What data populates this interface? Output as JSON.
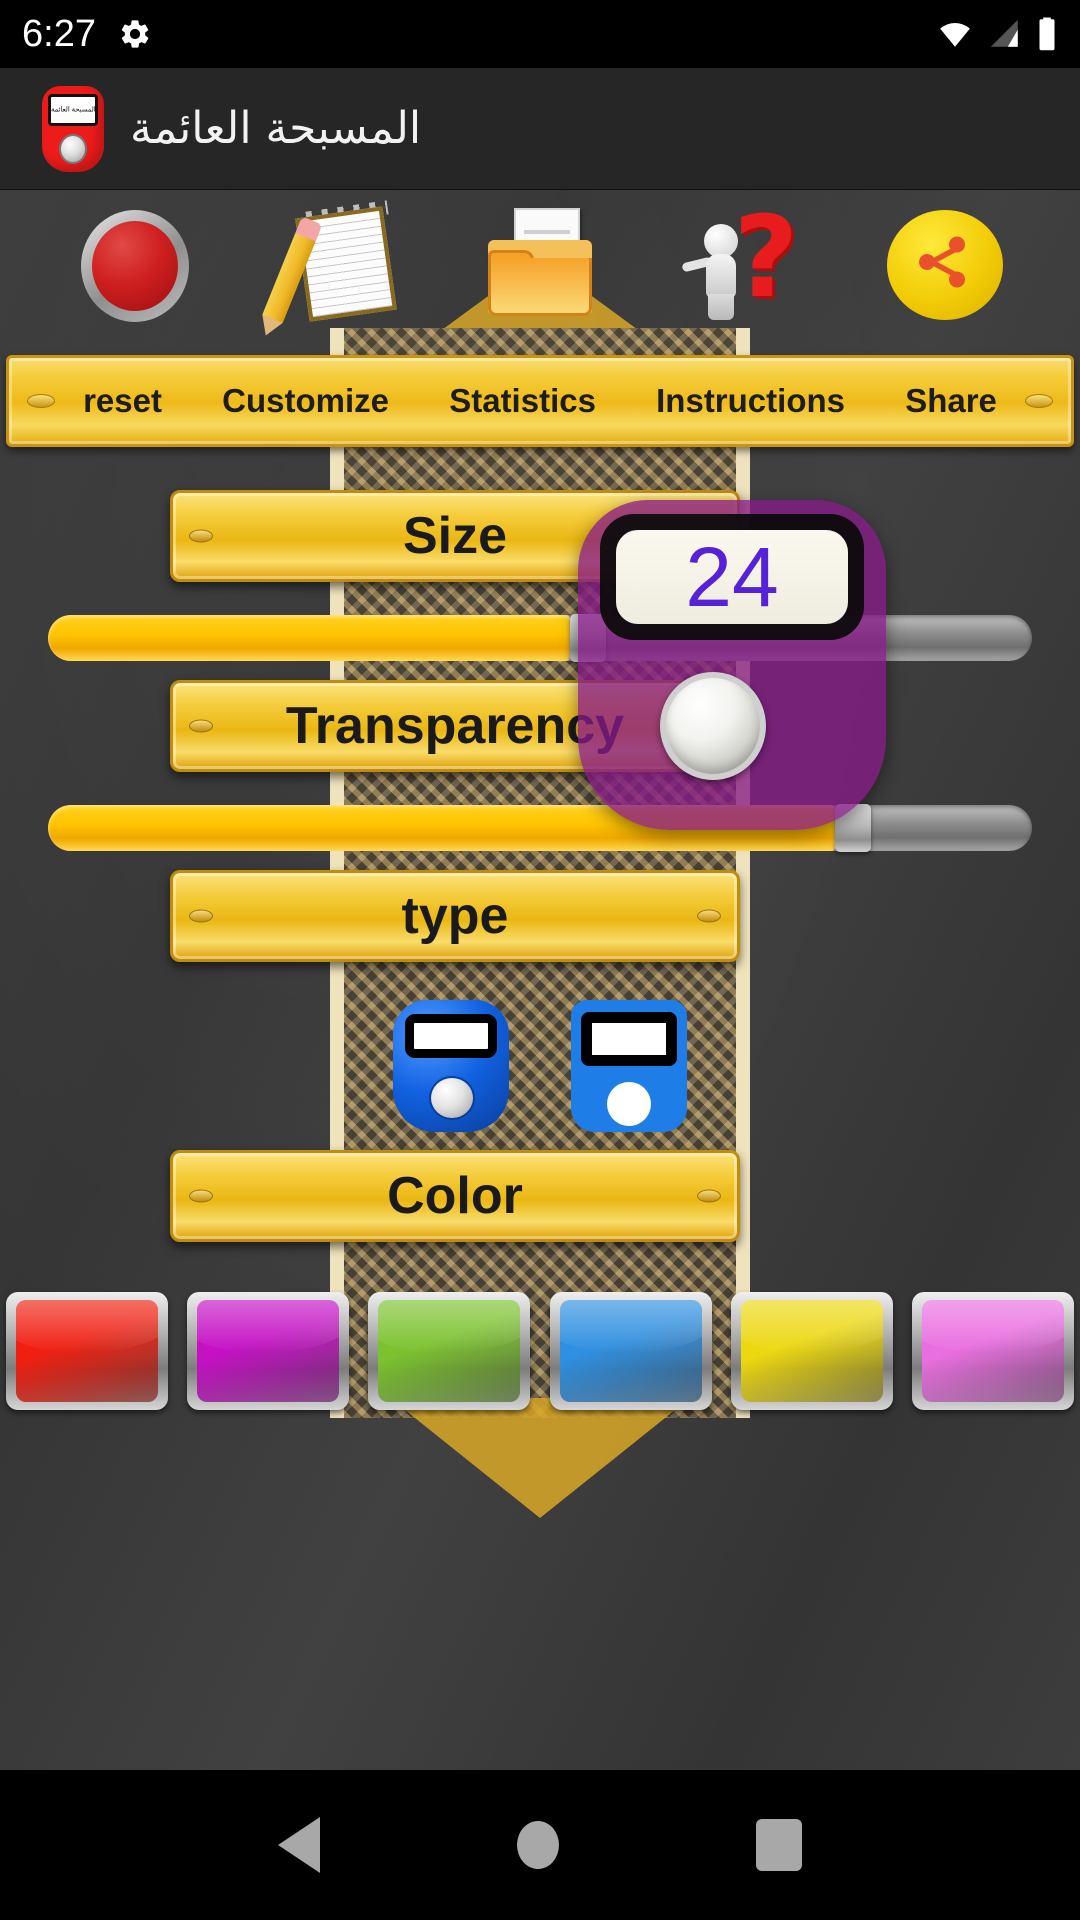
{
  "status_bar": {
    "time": "6:27",
    "icons": [
      "gear-icon",
      "wifi-icon",
      "cellular-signal-icon",
      "battery-icon"
    ]
  },
  "app_bar": {
    "title": "المسبحة العائمة",
    "logo_screen_text": "المسبحة العائمة",
    "logo_name": "app-logo-tasbih-counter"
  },
  "toolbar": {
    "items": [
      {
        "name": "reset-icon",
        "label": "reset"
      },
      {
        "name": "customize-icon",
        "label": "Customize"
      },
      {
        "name": "statistics-icon",
        "label": "Statistics"
      },
      {
        "name": "instructions-icon",
        "label": "Instructions"
      },
      {
        "name": "share-icon",
        "label": "Share"
      }
    ]
  },
  "nav": {
    "items": [
      {
        "label": "reset"
      },
      {
        "label": "Customize"
      },
      {
        "label": "Statistics"
      },
      {
        "label": "Instructions"
      },
      {
        "label": "Share"
      }
    ]
  },
  "sections": {
    "size": {
      "label": "Size",
      "value_percent": 53
    },
    "transparency": {
      "label": "Transparency",
      "value_percent": 80
    },
    "type": {
      "label": "type"
    },
    "color": {
      "label": "Color"
    }
  },
  "type_options": [
    {
      "name": "counter-type-3d",
      "selected": true
    },
    {
      "name": "counter-type-flat",
      "selected": false
    }
  ],
  "colors": {
    "swatches": [
      {
        "name": "color-red",
        "hex": "#ef2012"
      },
      {
        "name": "color-magenta",
        "hex": "#c411c4"
      },
      {
        "name": "color-green",
        "hex": "#7cc22f"
      },
      {
        "name": "color-blue",
        "hex": "#2f8fe0"
      },
      {
        "name": "color-yellow",
        "hex": "#ecd811"
      },
      {
        "name": "color-pink",
        "hex": "#e96fe0"
      }
    ]
  },
  "floating_counter": {
    "count": "24",
    "count_color": "#5622d8",
    "body_color": "#851a85"
  },
  "android_nav": {
    "back": "back-icon",
    "home": "home-icon",
    "recents": "recents-icon"
  },
  "theme": {
    "accent_gold": "#eeb91a",
    "background_dark": "#3b3b3b",
    "appbar_dark": "#262626"
  }
}
